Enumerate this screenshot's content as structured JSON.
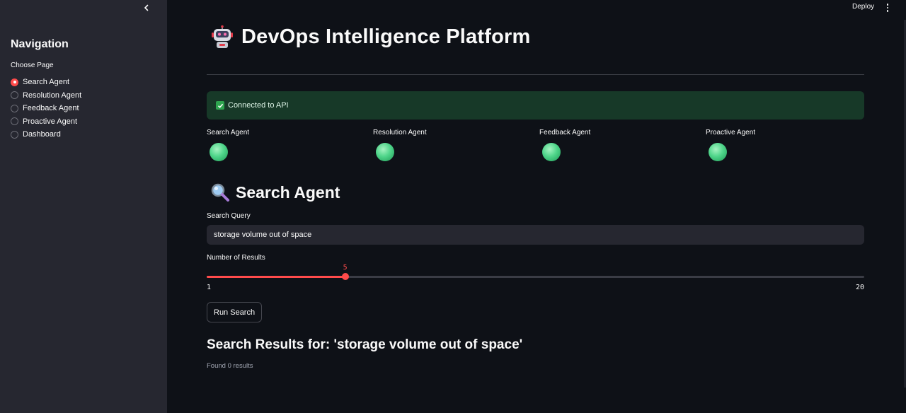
{
  "sidebar": {
    "collapse_icon": "chevron-left-icon",
    "title": "Navigation",
    "choose_label": "Choose Page",
    "options": [
      {
        "label": "Search Agent",
        "selected": true
      },
      {
        "label": "Resolution Agent",
        "selected": false
      },
      {
        "label": "Feedback Agent",
        "selected": false
      },
      {
        "label": "Proactive Agent",
        "selected": false
      },
      {
        "label": "Dashboard",
        "selected": false
      }
    ]
  },
  "header": {
    "deploy_label": "Deploy",
    "menu_icon": "kebab-menu-icon"
  },
  "main": {
    "title_icon": "robot-icon",
    "title": "DevOps Intelligence Platform",
    "status_message": "Connected to API",
    "status_icon": "checkmark-icon",
    "agents": [
      {
        "label": "Search Agent",
        "status_color": "#4fd58a"
      },
      {
        "label": "Resolution Agent",
        "status_color": "#4fd58a"
      },
      {
        "label": "Feedback Agent",
        "status_color": "#4fd58a"
      },
      {
        "label": "Proactive Agent",
        "status_color": "#4fd58a"
      }
    ],
    "section_icon": "magnifier-icon",
    "section_title": "Search Agent",
    "query_label": "Search Query",
    "query_value": "storage volume out of space",
    "results_label": "Number of Results",
    "slider": {
      "min": 1,
      "max": 20,
      "value": 5,
      "value_text": "5",
      "min_text": "1",
      "max_text": "20"
    },
    "run_button": "Run Search",
    "results_title": "Search Results for: 'storage volume out of space'",
    "results_count": "Found 0 results"
  },
  "colors": {
    "accent": "#ff4b4b",
    "background": "#0e1117",
    "sidebar": "#262730",
    "success_bg": "#173928",
    "status_green": "#4fd58a"
  }
}
